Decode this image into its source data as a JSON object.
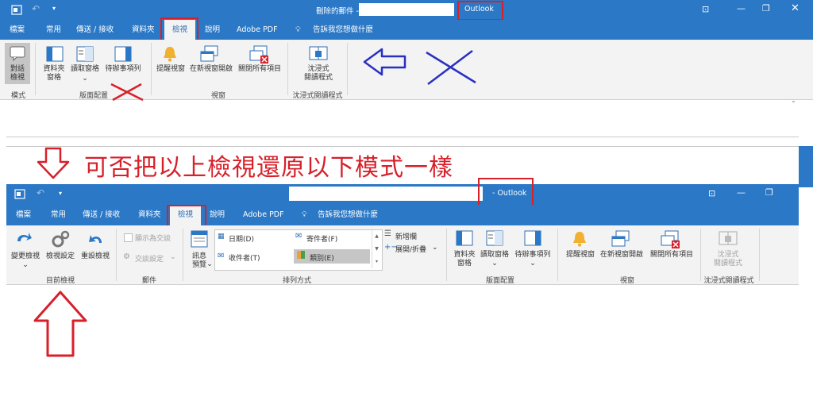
{
  "top": {
    "title_prefix": "刪除的郵件 -",
    "app": "Outlook",
    "tabs": [
      "檔案",
      "常用",
      "傳送 / 接收",
      "資料夾",
      "檢視",
      "說明",
      "Adobe PDF",
      "告訴我您想做什麼"
    ],
    "ribbon": {
      "mode_button": "對話\n檢視",
      "mode_group": "模式",
      "folder_pane": "資料夾\n窗格",
      "reading_pane": "讀取窗格",
      "todo_bar": "待辦事項列",
      "layout_group": "版面配置",
      "reminders": "提醒視窗",
      "open_new": "在新視窗開啟",
      "close_all": "關閉所有項目",
      "window_group": "視窗",
      "immersive": "沈浸式\n閱讀程式",
      "immersive_group": "沈浸式閱讀程式"
    }
  },
  "instruction": "可否把以上檢視還原以下模式一樣",
  "bottom": {
    "app": "- Outlook",
    "tabs": [
      "檔案",
      "常用",
      "傳送 / 接收",
      "資料夾",
      "檢視",
      "說明",
      "Adobe PDF",
      "告訴我您想做什麼"
    ],
    "ribbon": {
      "change_view": "變更檢視",
      "view_settings": "檢視設定",
      "reset_view": "重設檢視",
      "current_view_group": "目前檢視",
      "show_as_conversations": "顯示為交談",
      "conversation_settings": "交談設定",
      "messages_group": "郵件",
      "message_preview": "訊息\n預覽",
      "arrange_date": "日期(D)",
      "arrange_from": "寄件者(F)",
      "arrange_to": "收件者(T)",
      "arrange_categories": "類別(E)",
      "add_columns": "新增欄",
      "expand_collapse": "展開/折疊",
      "arrangement_group": "排列方式",
      "folder_pane": "資料夾\n窗格",
      "reading_pane": "讀取窗格",
      "todo_bar": "待辦事項列",
      "layout_group": "版面配置",
      "reminders": "提醒視窗",
      "open_new": "在新視窗開啟",
      "close_all": "關閉所有項目",
      "window_group": "視窗",
      "immersive": "沈浸式\n閱讀程式",
      "immersive_group": "沈浸式閱讀程式"
    }
  },
  "colors": {
    "ribbon_blue": "#2b78c6",
    "annotation_red": "#d8202a",
    "annotation_blue": "#2a2fc2"
  }
}
